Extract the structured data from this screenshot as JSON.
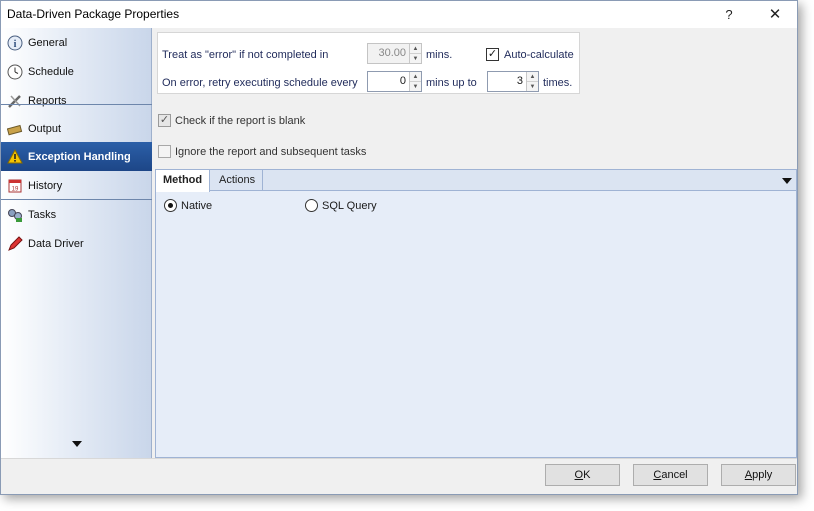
{
  "window": {
    "title": "Data-Driven Package Properties",
    "help_label": "?",
    "close_label": "✕"
  },
  "sidebar": {
    "items": [
      {
        "label": "General",
        "icon": "info-icon"
      },
      {
        "label": "Schedule",
        "icon": "clock-icon"
      },
      {
        "label": "Reports",
        "icon": "tools-icon"
      },
      {
        "label": "Output",
        "icon": "output-icon"
      },
      {
        "label": "Exception Handling",
        "icon": "warning-icon",
        "active": true
      },
      {
        "label": "History",
        "icon": "calendar-icon"
      },
      {
        "label": "Tasks",
        "icon": "tasks-icon"
      },
      {
        "label": "Data Driver",
        "icon": "pencil-icon"
      }
    ]
  },
  "exception": {
    "treat_error_label": "Treat as \"error\" if not completed in",
    "timeout_value": "30.00",
    "mins_label": "mins.",
    "autocalc_label": "Auto-calculate",
    "autocalc_checked": true,
    "retry_label": "On error, retry  executing schedule every",
    "retry_every_value": "0",
    "mins_up_to_label": "mins up to",
    "retry_times_value": "3",
    "times_label": "times.",
    "blank_check_label": "Check if the report is blank",
    "blank_check_checked": true,
    "ignore_label": "Ignore the report and subsequent tasks",
    "ignore_checked": false
  },
  "tabs": [
    {
      "label": "Method",
      "active": true
    },
    {
      "label": "Actions",
      "active": false
    }
  ],
  "method": {
    "options": [
      {
        "label": "Native",
        "selected": true
      },
      {
        "label": "SQL Query",
        "selected": false
      }
    ]
  },
  "buttons": {
    "ok_prefix": "",
    "ok_mnemonic": "O",
    "ok_rest": "K",
    "cancel_prefix": "",
    "cancel_mnemonic": "C",
    "cancel_rest": "ancel",
    "apply_prefix": "",
    "apply_mnemonic": "A",
    "apply_rest": "pply"
  },
  "colors": {
    "active_nav": "#1d4687",
    "label_text": "#1f2a5a"
  }
}
